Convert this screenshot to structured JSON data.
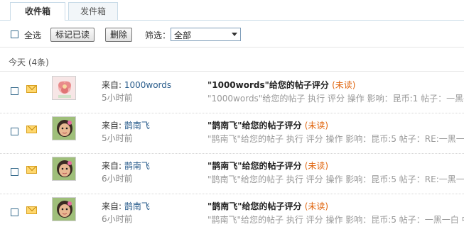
{
  "tabs": [
    {
      "label": "收件箱",
      "active": true
    },
    {
      "label": "发件箱",
      "active": false
    }
  ],
  "toolbar": {
    "select_all_label": "全选",
    "mark_read_label": "标记已读",
    "delete_label": "删除",
    "filter_label": "筛选：",
    "filter_value": "全部"
  },
  "section": {
    "label": "今天 (4条)"
  },
  "messages": [
    {
      "from_prefix": "来自: ",
      "from": "1000words",
      "time": "5小时前",
      "subject": "\"1000words\"给您的帖子评分",
      "status": "(未读)",
      "preview": "\"1000words\"给您的帖子 执行 评分 操作 影响：昆币:1 帖子：一黑一白 中间是豆腐",
      "avatar": "flower-avatar"
    },
    {
      "from_prefix": "来自: ",
      "from": "鹊南飞",
      "time": "5小时前",
      "subject": "\"鹊南飞\"给您的帖子评分",
      "status": "(未读)",
      "preview": "\"鹊南飞\"给您的帖子 执行 评分 操作 影响：昆币:5 帖子：RE:一黑一白 中间是豆腐",
      "avatar": "child-avatar"
    },
    {
      "from_prefix": "来自: ",
      "from": "鹊南飞",
      "time": "6小时前",
      "subject": "\"鹊南飞\"给您的帖子评分",
      "status": "(未读)",
      "preview": "\"鹊南飞\"给您的帖子 执行 评分 操作 影响：昆币:5 帖子：RE:一黑一白 中间是豆腐",
      "avatar": "child-avatar"
    },
    {
      "from_prefix": "来自: ",
      "from": "鹊南飞",
      "time": "6小时前",
      "subject": "\"鹊南飞\"给您的帖子评分",
      "status": "(未读)",
      "preview": "\"鹊南飞\"给您的帖子 执行 评分 操作 影响：昆币:5 帖子：一黑一白 中间是豆腐",
      "avatar": "child-avatar"
    }
  ],
  "colors": {
    "accent_link": "#2a5d8c",
    "unread": "#e0650e",
    "border": "#c9dbe8"
  }
}
